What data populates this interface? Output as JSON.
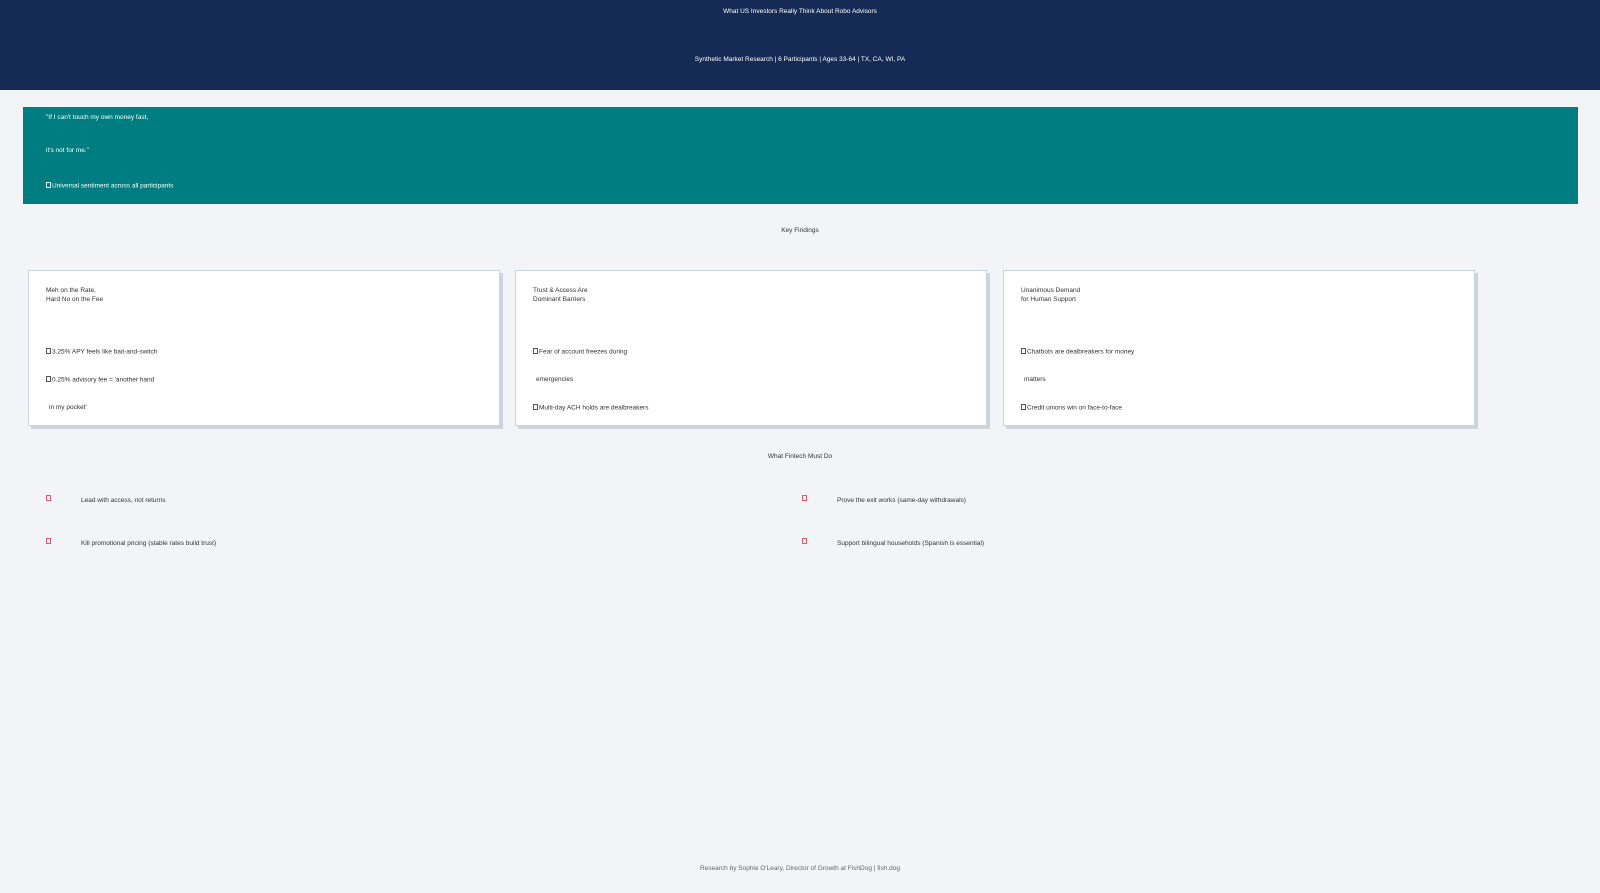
{
  "header": {
    "title": "What US Investors Really Think About Robo Advisors",
    "subtitle": "Synthetic Market Research | 6 Participants | Ages 33-64 | TX, CA, WI, PA"
  },
  "quote": {
    "line1": "\"If I can't touch my own money fast,",
    "line2": "it's not for me.\"",
    "attribution": "Universal sentiment across all participants",
    "attribution_icon": "users-icon"
  },
  "key_findings": {
    "heading": "Key Findings",
    "cards": [
      {
        "title": "Meh on the Rate,\nHard No on the Fee",
        "items": [
          "3.25% APY feels like bait-and-switch",
          "0.25% advisory fee = 'another hand",
          "in my pocket'"
        ]
      },
      {
        "title": "Trust & Access Are\nDominant Barriers",
        "items": [
          "Fear of account freezes during",
          "emergencies",
          "Multi-day ACH holds are dealbreakers"
        ]
      },
      {
        "title": "Unanimous Demand\nfor Human Support",
        "items": [
          "Chatbots are dealbreakers for money",
          "matters",
          "Credit unions win on face-to-face"
        ]
      }
    ]
  },
  "actions": {
    "heading": "What Fintech Must Do",
    "items": [
      "Lead with access, not returns",
      "Prove the exit works (same-day withdrawals)",
      "Kill promotional pricing (stable rates build trust)",
      "Support bilingual households (Spanish is essential)"
    ],
    "icon": "check-icon",
    "icon_color": "#e05a6a"
  },
  "footer": {
    "credit": "Research by Sophie O'Leary, Director of Growth at FishDog | fish.dog"
  },
  "colors": {
    "header_bg": "#152b55",
    "banner_bg": "#007d80",
    "page_bg": "#f2f4f7"
  }
}
